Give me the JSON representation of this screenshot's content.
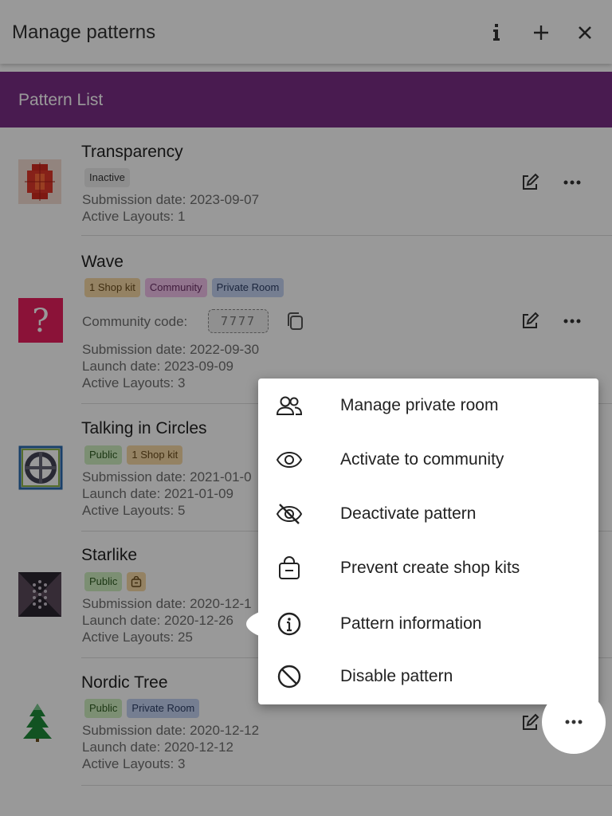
{
  "header": {
    "title": "Manage patterns",
    "info_icon": "info-icon",
    "add_icon": "plus-icon",
    "close_icon": "close-icon"
  },
  "band": {
    "title": "Pattern List"
  },
  "patterns": [
    {
      "name": "Transparency",
      "tags": [
        "Inactive"
      ],
      "submission": "Submission date: 2023-09-07",
      "active_layouts": "Active Layouts: 1"
    },
    {
      "name": "Wave",
      "tags": [
        "1 Shop kit",
        "Community",
        "Private Room"
      ],
      "community_code_label": "Community code:",
      "community_code": "7777",
      "submission": "Submission date: 2022-09-30",
      "launch": "Launch date: 2023-09-09",
      "active_layouts": "Active Layouts: 3"
    },
    {
      "name": "Talking in Circles",
      "tags": [
        "Public",
        "1 Shop kit"
      ],
      "submission": "Submission date: 2021-01-0",
      "launch": "Launch date: 2021-01-09",
      "active_layouts": "Active Layouts: 5"
    },
    {
      "name": "Starlike",
      "tags": [
        "Public"
      ],
      "submission": "Submission date: 2020-12-1",
      "launch": "Launch date: 2020-12-26",
      "active_layouts": "Active Layouts: 25"
    },
    {
      "name": "Nordic Tree",
      "tags": [
        "Public",
        "Private Room"
      ],
      "submission": "Submission date: 2020-12-12",
      "launch": "Launch date: 2020-12-12",
      "active_layouts": "Active Layouts: 3"
    }
  ],
  "context_menu": {
    "items": [
      {
        "label": "Manage private room",
        "icon": "people-icon"
      },
      {
        "label": "Activate to community",
        "icon": "eye-icon"
      },
      {
        "label": "Deactivate pattern",
        "icon": "eye-off-icon"
      },
      {
        "label": "Prevent create shop kits",
        "icon": "shop-bag-icon"
      },
      {
        "label": "Pattern information",
        "icon": "info-circle-icon"
      },
      {
        "label": "Disable pattern",
        "icon": "block-icon"
      }
    ],
    "highlighted_item": "Pattern information"
  },
  "colors": {
    "band": "#7b2d86",
    "overlay": "rgba(0,0,0,0.40)"
  }
}
